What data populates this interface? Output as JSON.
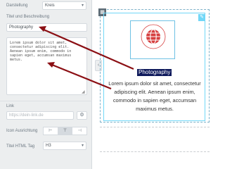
{
  "panel": {
    "display_label": "Darstellung",
    "display_value": "Kreis",
    "title_desc_label": "Titel und Beschreibung",
    "title_value": "Photography",
    "description_value": "Lorem ipsum dolor sit amet, consectetur adipiscing elit. Aenean ipsum enim, commodo in sapien eget, accumsan maximus metus.",
    "link_label": "Link",
    "link_placeholder": "https://dein-link.de",
    "icon_align_label": "Icon Ausrichtung",
    "html_tag_label": "Titel HTML Tag",
    "html_tag_value": "H3",
    "align_options": [
      "left-align-icon",
      "top-align-icon",
      "right-align-icon"
    ],
    "align_selected": 1
  },
  "preview": {
    "heading": "Photography",
    "description": "Lorem ipsum dolor sit amet, consectetur adipiscing elit. Aenean ipsum enim, commodo in sapien eget, accumsan maximus metus.",
    "icon": "globe-icon"
  },
  "colors": {
    "icon_accent": "#d63f3f",
    "arrow": "#8b0f14",
    "heading_highlight": "#0f1a5c",
    "selection_border": "#71d7f7"
  }
}
